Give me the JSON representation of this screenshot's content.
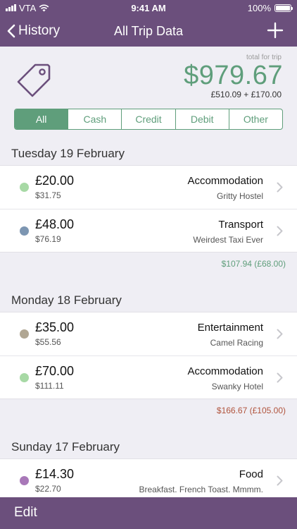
{
  "status": {
    "carrier": "VTA",
    "time": "9:41 AM",
    "battery": "100%"
  },
  "nav": {
    "back_label": "History",
    "title": "All Trip Data"
  },
  "summary": {
    "total_label": "total for trip",
    "total_amount": "$979.67",
    "breakdown": "£510.09 + £170.00"
  },
  "filters": {
    "all": "All",
    "cash": "Cash",
    "credit": "Credit",
    "debit": "Debit",
    "other": "Other",
    "selected": "All"
  },
  "sections": [
    {
      "date": "Tuesday 19 February",
      "entries": [
        {
          "amount": "£20.00",
          "converted": "$31.75",
          "category": "Accommodation",
          "place": "Gritty Hostel",
          "color": "#a7d9a5"
        },
        {
          "amount": "£48.00",
          "converted": "$76.19",
          "category": "Transport",
          "place": "Weirdest Taxi Ever",
          "color": "#7d96b2"
        }
      ],
      "total": "$107.94  (£68.00)",
      "total_color": "#5f9e7b"
    },
    {
      "date": "Monday 18 February",
      "entries": [
        {
          "amount": "£35.00",
          "converted": "$55.56",
          "category": "Entertainment",
          "place": "Camel Racing",
          "color": "#b0a693"
        },
        {
          "amount": "£70.00",
          "converted": "$111.11",
          "category": "Accommodation",
          "place": "Swanky Hotel",
          "color": "#a7d9a5"
        }
      ],
      "total": "$166.67  (£105.00)",
      "total_color": "#b0533c"
    },
    {
      "date": "Sunday 17 February",
      "entries": [
        {
          "amount": "£14.30",
          "converted": "$22.70",
          "category": "Food",
          "place": "Breakfast. French Toast. Mmmm.",
          "color": "#a878b8"
        }
      ]
    }
  ],
  "toolbar": {
    "edit_label": "Edit"
  },
  "colors": {
    "bar": "#6b4f7c",
    "accent": "#5f9e7b",
    "negative": "#b0533c"
  }
}
